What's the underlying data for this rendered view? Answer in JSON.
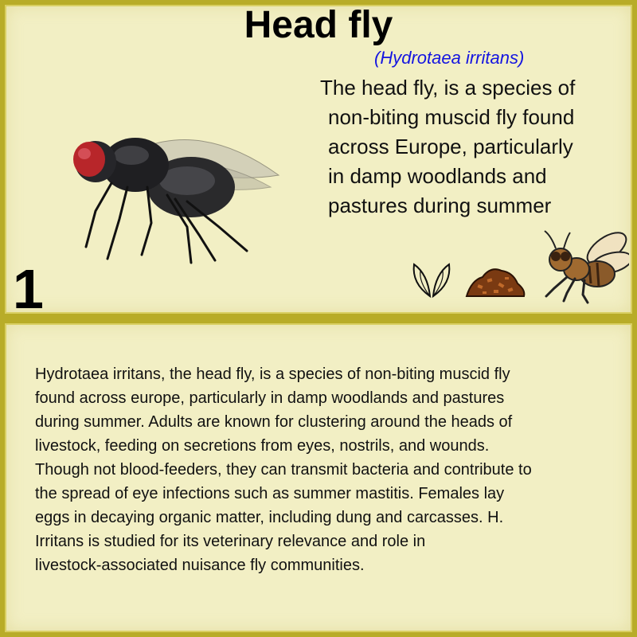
{
  "card": {
    "title": "Head fly",
    "scientific_name": "(Hydrotaea irritans)",
    "summary_lines": [
      "The head fly, is a species of",
      "non-biting muscid fly found",
      "across Europe, particularly",
      "in damp woodlands and",
      "pastures during summer"
    ],
    "number": "1",
    "icons": [
      "fly-photo",
      "wings-icon",
      "dung-pile-icon",
      "fly-icon"
    ]
  },
  "description": {
    "lines": [
      "Hydrotaea irritans, the head fly, is a species of non-biting muscid fly",
      "found across europe, particularly in damp woodlands and pastures",
      "during summer. Adults are known for clustering around the heads of",
      "livestock, feeding on secretions from eyes, nostrils, and wounds.",
      "Though not blood-feeders, they can transmit bacteria and contribute to",
      "the spread of eye infections such as summer mastitis. Females lay",
      "eggs in decaying organic matter, including dung and carcasses. H.",
      "Irritans is studied for its veterinary relevance and role in",
      "livestock-associated nuisance fly communities."
    ]
  },
  "colors": {
    "background": "#f2efc4",
    "border": "#b8ac28",
    "scientific_name": "#1515e0"
  }
}
